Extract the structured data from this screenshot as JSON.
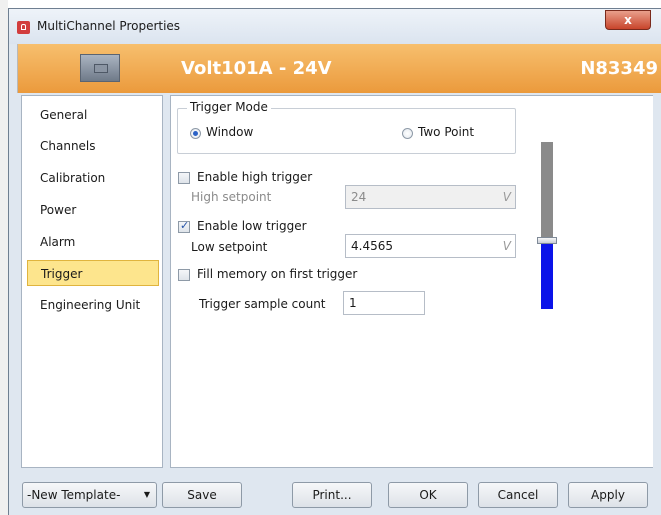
{
  "window": {
    "title": "MultiChannel Properties",
    "close_glyph": "x"
  },
  "header": {
    "device_name": "Volt101A - 24V",
    "serial": "N83349"
  },
  "nav": {
    "items": [
      {
        "label": "General"
      },
      {
        "label": "Channels"
      },
      {
        "label": "Calibration"
      },
      {
        "label": "Power"
      },
      {
        "label": "Alarm"
      },
      {
        "label": "Trigger",
        "selected": true
      },
      {
        "label": "Engineering Unit"
      }
    ]
  },
  "trigger": {
    "mode_title": "Trigger Mode",
    "mode_window": "Window",
    "mode_two_point": "Two Point",
    "selected_mode": "Window",
    "enable_high_label": "Enable high trigger",
    "enable_high_checked": false,
    "high_setpoint_label": "High setpoint",
    "high_setpoint_value": "24",
    "high_unit": "V",
    "enable_low_label": "Enable low trigger",
    "enable_low_checked": true,
    "low_setpoint_label": "Low setpoint",
    "low_setpoint_value": "4.4565",
    "low_unit": "V",
    "fill_memory_label": "Fill memory on first trigger",
    "fill_memory_checked": false,
    "sample_count_label": "Trigger sample count",
    "sample_count_value": "1",
    "level_fraction": 0.39,
    "level_color": "#0b13e9"
  },
  "footer": {
    "template_label": "-New Template-",
    "save_label": "Save",
    "print_label": "Print...",
    "ok_label": "OK",
    "cancel_label": "Cancel",
    "apply_label": "Apply"
  },
  "colors": {
    "header_orange": "#f0a64a",
    "selected_nav": "#fde58d"
  }
}
